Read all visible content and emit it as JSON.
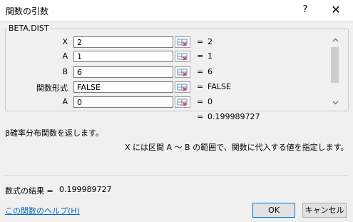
{
  "dialog": {
    "title": "関数の引数",
    "help_symbol": "?",
    "close_symbol": "✕"
  },
  "function": {
    "name": "BETA.DIST",
    "args": [
      {
        "label": "X",
        "value": "2",
        "result": "2"
      },
      {
        "label": "A",
        "value": "1",
        "result": "1"
      },
      {
        "label": "B",
        "value": "6",
        "result": "6"
      },
      {
        "label": "関数形式",
        "value": "FALSE",
        "result": "FALSE"
      },
      {
        "label": "A",
        "value": "0",
        "result": "0"
      }
    ],
    "equals": "=",
    "overall_result": "0.199989727",
    "description": "β確率分布関数を返します。",
    "arg_help": "X には区間 A ～ B の範囲で、関数に代入する値を指定します。"
  },
  "footer": {
    "formula_result_label": "数式の結果 =",
    "formula_result_value": "0.199989727",
    "help_link": "この関数のヘルプ(H)",
    "ok_label": "OK",
    "cancel_label": "キャンセル"
  },
  "colors": {
    "link": "#0066cc",
    "focus_border": "#0078d7",
    "ref_icon_accent": "#d12b2b"
  },
  "icons": {
    "reference": "range-select-icon",
    "scroll_up": "chevron-up-icon",
    "scroll_down": "chevron-down-icon"
  }
}
